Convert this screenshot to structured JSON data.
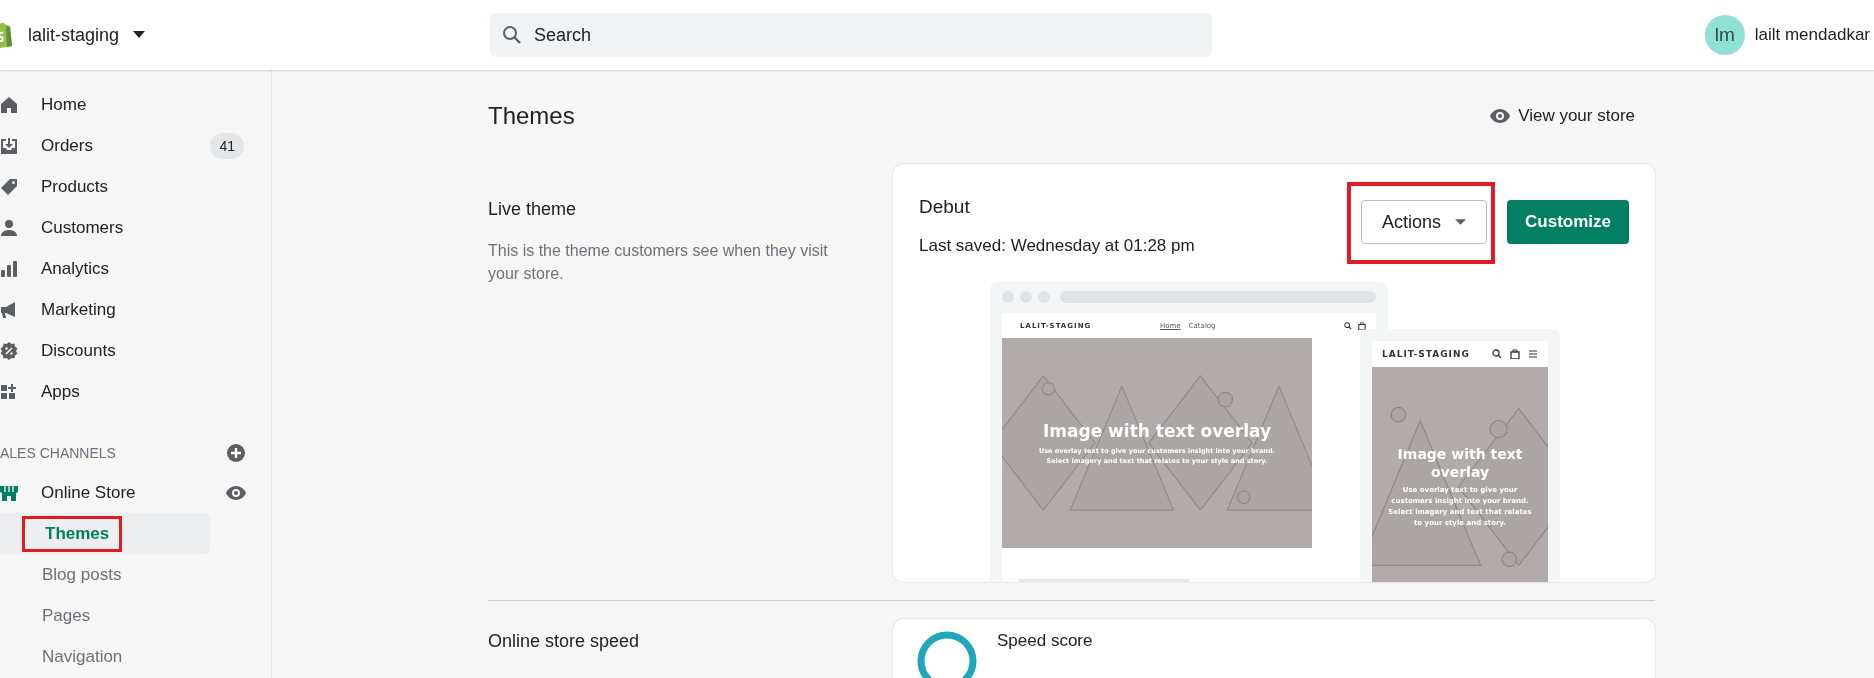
{
  "topbar": {
    "store_name": "lalit-staging",
    "search": {
      "placeholder": "Search"
    },
    "user": {
      "initials": "lm",
      "name": "lailt mendadkar"
    }
  },
  "sidebar": {
    "items": [
      {
        "kind": "home",
        "label": "Home"
      },
      {
        "kind": "orders",
        "label": "Orders",
        "badge": "41"
      },
      {
        "kind": "products",
        "label": "Products"
      },
      {
        "kind": "customers",
        "label": "Customers"
      },
      {
        "kind": "analytics",
        "label": "Analytics"
      },
      {
        "kind": "marketing",
        "label": "Marketing"
      },
      {
        "kind": "discounts",
        "label": "Discounts"
      },
      {
        "kind": "apps",
        "label": "Apps"
      }
    ],
    "section_title": "ALES CHANNELS",
    "channel": {
      "label": "Online Store",
      "children": [
        {
          "label": "Themes",
          "selected": true,
          "highlighted": true
        },
        {
          "label": "Blog posts",
          "selected": false,
          "highlighted": false
        },
        {
          "label": "Pages",
          "selected": false,
          "highlighted": false
        },
        {
          "label": "Navigation",
          "selected": false,
          "highlighted": false
        }
      ]
    }
  },
  "main": {
    "title": "Themes",
    "view_store": "View your store",
    "live_theme": {
      "heading": "Live theme",
      "description": "This is the theme customers see when they visit your store."
    },
    "card": {
      "theme_name": "Debut",
      "last_saved": "Last saved: Wednesday at 01:28 pm",
      "actions": {
        "label": "Actions",
        "highlighted": true
      },
      "customize": "Customize",
      "preview": {
        "desktop": {
          "store_name": "LALIT-STAGING",
          "nav_links": [
            {
              "label": "Home",
              "selected": true
            },
            {
              "label": "Catalog",
              "selected": false
            }
          ],
          "hero_title": "Image with text overlay",
          "hero_text": "Use overlay text to give your customers insight into your brand. Select imagery and text that relates to your style and story."
        },
        "mobile": {
          "store_name": "LALIT-STAGING",
          "hero_title": "Image with text overlay",
          "hero_text": "Use overlay text to give your customers insight into your brand. Select imagery and text that relates to your style and story."
        }
      }
    },
    "speed": {
      "heading": "Online store speed",
      "card_title": "Speed score"
    }
  }
}
